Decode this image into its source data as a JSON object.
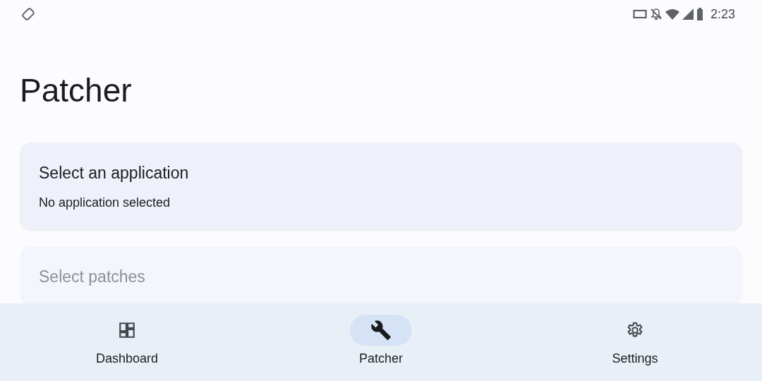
{
  "status_bar": {
    "time": "2:23"
  },
  "title": "Patcher",
  "cards": [
    {
      "title": "Select an application",
      "subtitle": "No application selected",
      "disabled": false
    },
    {
      "title": "Select patches",
      "disabled": true
    }
  ],
  "nav": [
    {
      "label": "Dashboard",
      "kind": "dashboard",
      "selected": false
    },
    {
      "label": "Patcher",
      "kind": "wrench",
      "selected": true
    },
    {
      "label": "Settings",
      "kind": "gear",
      "selected": false
    }
  ]
}
